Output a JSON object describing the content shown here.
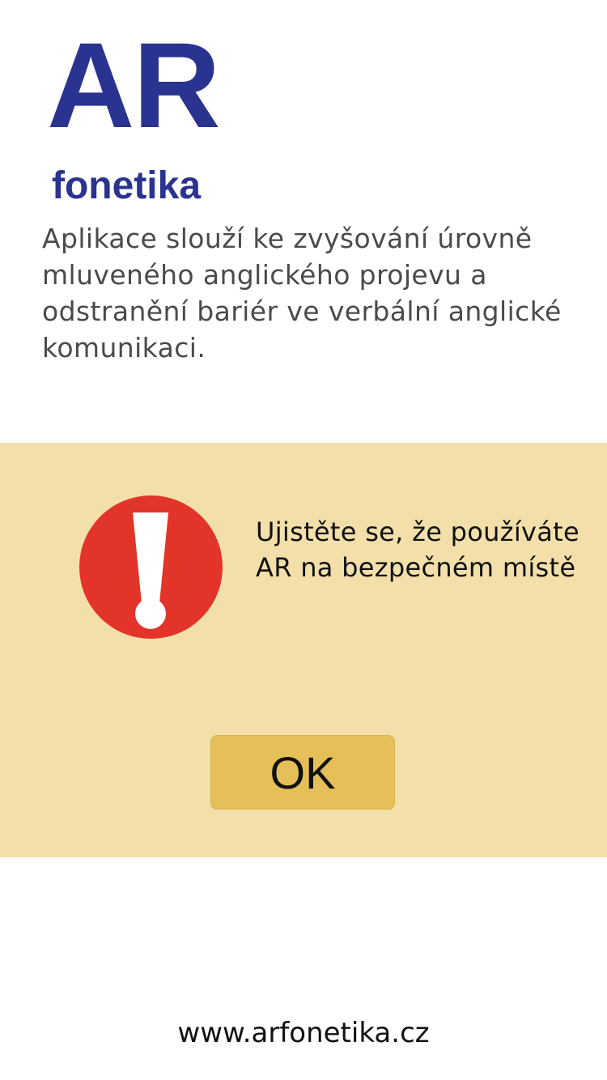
{
  "logo": {
    "title": "AR",
    "subtitle": "fonetika"
  },
  "description": "Aplikace slouží ke zvyšování úrovně mluveného anglického projevu a odstranění bariér ve verbální anglické komunikaci.",
  "warning": {
    "icon": "exclamation-icon",
    "message": "Ujistěte se, že používáte AR na bezpečném místě",
    "ok_label": "OK"
  },
  "footer": {
    "website": "www.arfonetika.cz"
  },
  "colors": {
    "brand": "#2b3390",
    "panel_background": "#f2dfa9",
    "button": "#e5bf57",
    "warning_red": "#e23428"
  }
}
